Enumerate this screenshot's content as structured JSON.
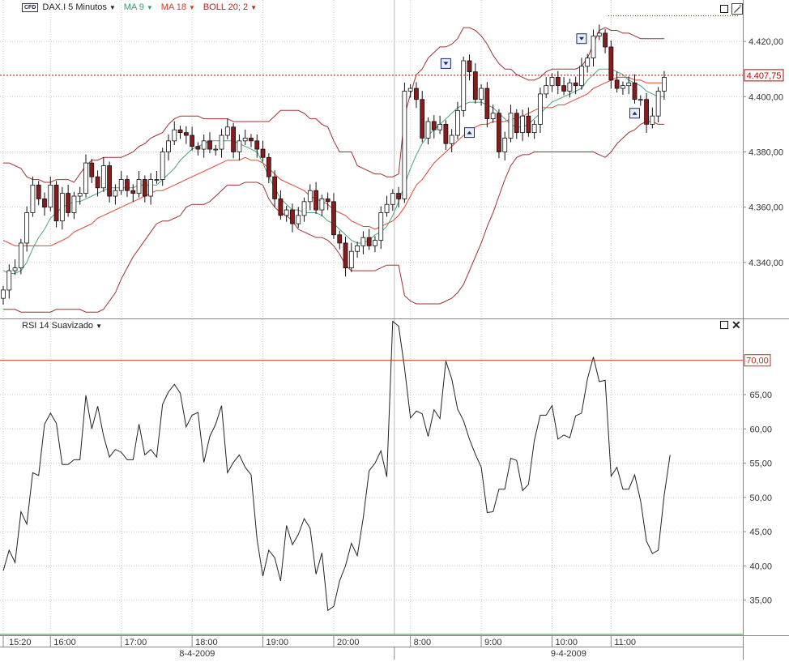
{
  "header_main": {
    "symbol": "DAX.I 5 Minutos",
    "ma9": "MA 9",
    "ma18": "MA 18",
    "boll": "BOLL 20; 2",
    "colors": {
      "symbol": "#1a1a1a",
      "ma9": "#3a9a6a",
      "ma18": "#d23a2a",
      "boll": "#b02525"
    }
  },
  "header_rsi": {
    "label": "RSI 14 Suavizado"
  },
  "price_tag": "4.407,75",
  "rsi_level_tag": "70,00",
  "colors": {
    "bull_fill": "#ffffff",
    "bear_fill": "#8b1a1a",
    "candle_outline": "#111111",
    "boll_band": "#a03030",
    "ma9_line": "#4aa57a",
    "ma18_line": "#e04535",
    "price_line": "#c00000",
    "rsi_line": "#222222",
    "rsi_70_line": "#c03020",
    "rsi_30_line": "#2a9a2a",
    "grid": "#c8c8c8"
  },
  "chart_data": [
    {
      "type": "candlestick",
      "title": "DAX.I 5 Minutos",
      "ylim": [
        4320,
        4435
      ],
      "yticks": [
        "4.420,00",
        "4.400,00",
        "4.380,00",
        "4.360,00",
        "4.340,00"
      ],
      "ytick_values": [
        4420,
        4400,
        4380,
        4360,
        4340
      ],
      "current_price": 4407.75,
      "grid": true,
      "series": [
        {
          "name": "DAX.I",
          "close": [
            4330,
            4337,
            4338,
            4347,
            4358,
            4368,
            4363,
            4360,
            4368,
            4355,
            4365,
            4358,
            4364,
            4365,
            4376,
            4371,
            4367,
            4375,
            4364,
            4366,
            4370,
            4366,
            4365,
            4370,
            4364,
            4370,
            4370,
            4380,
            4384,
            4388,
            4387,
            4386,
            4382,
            4381,
            4384,
            4381,
            4381,
            4386,
            4389,
            4380,
            4384,
            4385,
            4384,
            4381,
            4378,
            4371,
            4363,
            4357,
            4359,
            4354,
            4357,
            4362,
            4366,
            4359,
            4363,
            4362,
            4350,
            4347,
            4338,
            4344,
            4346,
            4349,
            4346,
            4348,
            4358,
            4361,
            4365,
            4363,
            4402,
            4403,
            4399,
            4385,
            4391,
            4388,
            4390,
            4383,
            4386,
            4395,
            4413,
            4409,
            4399,
            4403,
            4392,
            4394,
            4380,
            4385,
            4394,
            4387,
            4393,
            4387,
            4390,
            4401,
            4404,
            4407,
            4404,
            4402,
            4405,
            4404,
            4411,
            4414,
            4422,
            4423,
            4418,
            4406,
            4403,
            4404,
            4405,
            4399,
            4399,
            4390,
            4393,
            4402,
            4407
          ]
        },
        {
          "name": "BOLL upper",
          "values": [
            4376,
            4376,
            4375,
            4374,
            4371,
            4370,
            4370,
            4369,
            4369,
            4370,
            4370,
            4370,
            4369,
            4372,
            4375,
            4377,
            4377,
            4378,
            4378,
            4378,
            4378,
            4379,
            4380,
            4382,
            4383,
            4385,
            4386,
            4387,
            4390,
            4392,
            4393,
            4393,
            4393,
            4393,
            4392,
            4392,
            4392,
            4392,
            4392,
            4391,
            4391,
            4391,
            4391,
            4391,
            4391,
            4391,
            4393,
            4395,
            4395,
            4395,
            4395,
            4394,
            4392,
            4392,
            4390,
            4389,
            4384,
            4380,
            4380,
            4380,
            4375,
            4374,
            4373,
            4372,
            4372,
            4371,
            4371,
            4372,
            4393,
            4401,
            4408,
            4410,
            4414,
            4416,
            4418,
            4418,
            4419,
            4421,
            4425,
            4425,
            4424,
            4422,
            4419,
            4415,
            4412,
            4410,
            4410,
            4408,
            4407,
            4406,
            4406,
            4407,
            4409,
            4410,
            4410,
            4410,
            4410,
            4410,
            4411,
            4414,
            4419,
            4424,
            4425,
            4424,
            4424,
            4423,
            4423,
            4422,
            4421,
            4421,
            4421,
            4421,
            4421
          ]
        },
        {
          "name": "BOLL lower",
          "values": [
            4323,
            4323,
            4323,
            4322,
            4322,
            4322,
            4322,
            4322,
            4322,
            4323,
            4323,
            4323,
            4323,
            4323,
            4322,
            4322,
            4322,
            4323,
            4326,
            4329,
            4334,
            4338,
            4342,
            4345,
            4348,
            4351,
            4354,
            4355,
            4355,
            4356,
            4357,
            4360,
            4361,
            4361,
            4361,
            4362,
            4364,
            4366,
            4368,
            4368,
            4368,
            4369,
            4369,
            4369,
            4368,
            4363,
            4360,
            4358,
            4357,
            4355,
            4352,
            4351,
            4350,
            4349,
            4349,
            4348,
            4346,
            4343,
            4339,
            4337,
            4337,
            4337,
            4337,
            4337,
            4338,
            4339,
            4339,
            4339,
            4328,
            4326,
            4325,
            4325,
            4325,
            4325,
            4325,
            4326,
            4327,
            4329,
            4332,
            4337,
            4342,
            4347,
            4353,
            4358,
            4364,
            4370,
            4375,
            4378,
            4379,
            4379,
            4380,
            4380,
            4380,
            4380,
            4380,
            4380,
            4380,
            4380,
            4380,
            4380,
            4380,
            4379,
            4378,
            4380,
            4383,
            4385,
            4387,
            4388,
            4390,
            4391,
            4391,
            4390,
            4390
          ]
        },
        {
          "name": "MA 9",
          "values": [
            4337,
            4336,
            4336,
            4337,
            4340,
            4345,
            4349,
            4352,
            4356,
            4358,
            4360,
            4361,
            4362,
            4362,
            4363,
            4364,
            4365,
            4366,
            4367,
            4367,
            4367,
            4367,
            4367,
            4368,
            4368,
            4368,
            4368,
            4370,
            4372,
            4374,
            4377,
            4379,
            4381,
            4382,
            4383,
            4384,
            4384,
            4384,
            4384,
            4384,
            4383,
            4382,
            4381,
            4380,
            4376,
            4371,
            4367,
            4363,
            4361,
            4359,
            4359,
            4358,
            4358,
            4358,
            4357,
            4355,
            4354,
            4352,
            4350,
            4348,
            4347,
            4347,
            4348,
            4350,
            4351,
            4353,
            4357,
            4362,
            4368,
            4374,
            4379,
            4383,
            4386,
            4388,
            4390,
            4392,
            4394,
            4396,
            4397,
            4398,
            4398,
            4398,
            4397,
            4396,
            4394,
            4392,
            4390,
            4389,
            4389,
            4390,
            4392,
            4394,
            4396,
            4398,
            4399,
            4400,
            4401,
            4402,
            4403,
            4406,
            4408,
            4410,
            4410,
            4410,
            4409,
            4408,
            4406,
            4405,
            4404,
            4402,
            4401,
            4400,
            4400
          ]
        },
        {
          "name": "MA 18",
          "values": [
            4348,
            4347,
            4346,
            4346,
            4346,
            4346,
            4346,
            4346,
            4346,
            4347,
            4348,
            4349,
            4351,
            4352,
            4353,
            4354,
            4356,
            4357,
            4358,
            4359,
            4360,
            4361,
            4362,
            4363,
            4364,
            4365,
            4366,
            4366,
            4367,
            4368,
            4369,
            4370,
            4371,
            4372,
            4373,
            4374,
            4375,
            4376,
            4377,
            4377,
            4377,
            4378,
            4377,
            4377,
            4376,
            4374,
            4372,
            4370,
            4369,
            4368,
            4367,
            4366,
            4364,
            4363,
            4362,
            4361,
            4359,
            4358,
            4357,
            4355,
            4354,
            4353,
            4353,
            4352,
            4353,
            4354,
            4355,
            4357,
            4360,
            4364,
            4368,
            4370,
            4373,
            4376,
            4378,
            4380,
            4382,
            4384,
            4386,
            4387,
            4389,
            4390,
            4390,
            4391,
            4391,
            4391,
            4392,
            4392,
            4393,
            4394,
            4395,
            4396,
            4396,
            4396,
            4397,
            4397,
            4398,
            4399,
            4400,
            4401,
            4403,
            4404,
            4405,
            4406,
            4407,
            4407,
            4407,
            4406,
            4406,
            4405,
            4405,
            4405,
            4405
          ]
        }
      ]
    },
    {
      "type": "line",
      "title": "RSI 14 Suavizado",
      "ylim": [
        30,
        76
      ],
      "yticks": [
        "65,00",
        "60,00",
        "55,00",
        "50,00",
        "45,00",
        "40,00",
        "35,00"
      ],
      "ytick_values": [
        65,
        60,
        55,
        50,
        45,
        40,
        35
      ],
      "levels": [
        {
          "label": "70,00",
          "value": 70
        },
        {
          "value": 30
        }
      ],
      "grid": true,
      "series": [
        {
          "name": "RSI 14",
          "values": [
            39.3,
            42.3,
            40.5,
            47.9,
            46.1,
            53.6,
            53.2,
            60.7,
            62.3,
            60.8,
            54.8,
            54.8,
            55.5,
            55.5,
            64.9,
            60.0,
            63.3,
            59.0,
            55.9,
            57.0,
            56.6,
            55.5,
            55.5,
            60.7,
            56.2,
            57.0,
            55.9,
            63.6,
            65.4,
            66.5,
            65.2,
            60.3,
            62.0,
            62.4,
            55.1,
            58.9,
            60.7,
            63.4,
            53.6,
            55.1,
            56.2,
            54.4,
            53.3,
            43.9,
            38.5,
            42.3,
            41.2,
            37.8,
            45.9,
            43.1,
            44.6,
            46.9,
            45.5,
            38.8,
            41.9,
            33.5,
            34.1,
            37.8,
            40.0,
            43.3,
            41.5,
            47.0,
            53.9,
            55.0,
            56.8,
            53.0,
            75.7,
            75.0,
            68.9,
            61.6,
            62.6,
            62.2,
            58.9,
            62.8,
            61.5,
            69.9,
            67.3,
            62.9,
            61.2,
            58.5,
            56.3,
            54.4,
            47.8,
            47.9,
            51.2,
            51.2,
            55.7,
            55.4,
            51.0,
            51.9,
            58.3,
            62.0,
            62.0,
            63.4,
            58.5,
            59.1,
            58.7,
            61.9,
            62.3,
            67.3,
            70.5,
            66.9,
            67.1,
            53.1,
            54.4,
            51.2,
            51.2,
            53.3,
            49.5,
            43.6,
            41.8,
            42.3,
            50.3,
            56.2
          ]
        }
      ]
    }
  ],
  "x_axis": {
    "time_labels": [
      "15:20",
      "16:00",
      "17:00",
      "18:00",
      "19:00",
      "20:00",
      "8:00",
      "9:00",
      "10:00",
      "11:00"
    ],
    "time_label_index": [
      0,
      8,
      20,
      32,
      44,
      56,
      69,
      81,
      93,
      103
    ],
    "date_labels": [
      "8-4-2009",
      "9-4-2009"
    ],
    "session_break_index": 66
  }
}
